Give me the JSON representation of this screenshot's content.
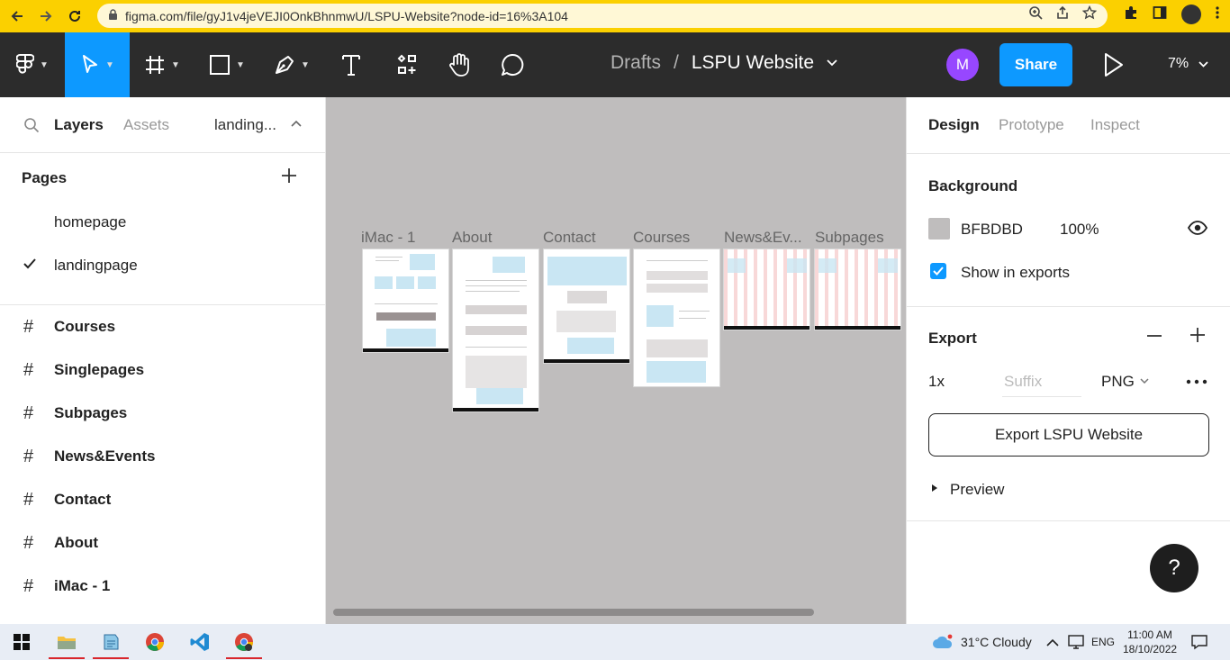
{
  "browser": {
    "url": "figma.com/file/gyJ1v4jeVEJI0OnkBhnmwU/LSPU-Website?node-id=16%3A104",
    "back_icon": "arrow-left",
    "forward_icon": "arrow-right",
    "reload_icon": "reload"
  },
  "toolbar": {
    "breadcrumb_folder": "Drafts",
    "breadcrumb_sep": "/",
    "file_name": "LSPU Website",
    "user_initial": "M",
    "share_label": "Share",
    "zoom_label": "7%",
    "accent": "#0d99ff"
  },
  "left": {
    "tabs": {
      "layers": "Layers",
      "assets": "Assets",
      "page": "landing..."
    },
    "pages_header": "Pages",
    "pages": [
      {
        "label": "homepage",
        "checked": false
      },
      {
        "label": "landingpage",
        "checked": true
      }
    ],
    "layers": [
      {
        "label": "Courses"
      },
      {
        "label": "Singlepages"
      },
      {
        "label": "Subpages"
      },
      {
        "label": "News&Events"
      },
      {
        "label": "Contact"
      },
      {
        "label": "About"
      },
      {
        "label": "iMac - 1"
      }
    ]
  },
  "canvas": {
    "background": "#BFBDBD",
    "frames": [
      {
        "label": "iMac - 1"
      },
      {
        "label": "About"
      },
      {
        "label": "Contact"
      },
      {
        "label": "Courses"
      },
      {
        "label": "News&Ev..."
      },
      {
        "label": "Subpages"
      }
    ]
  },
  "right": {
    "tabs": {
      "design": "Design",
      "prototype": "Prototype",
      "inspect": "Inspect"
    },
    "background_title": "Background",
    "bg_hex": "BFBDBD",
    "bg_opacity": "100%",
    "show_in_exports": "Show in exports",
    "export_title": "Export",
    "scale": "1x",
    "suffix_placeholder": "Suffix",
    "format": "PNG",
    "export_button": "Export LSPU Website",
    "preview_label": "Preview",
    "help_label": "?"
  },
  "taskbar": {
    "weather": "31°C  Cloudy",
    "lang": "ENG",
    "time": "11:00 AM",
    "date": "18/10/2022"
  }
}
